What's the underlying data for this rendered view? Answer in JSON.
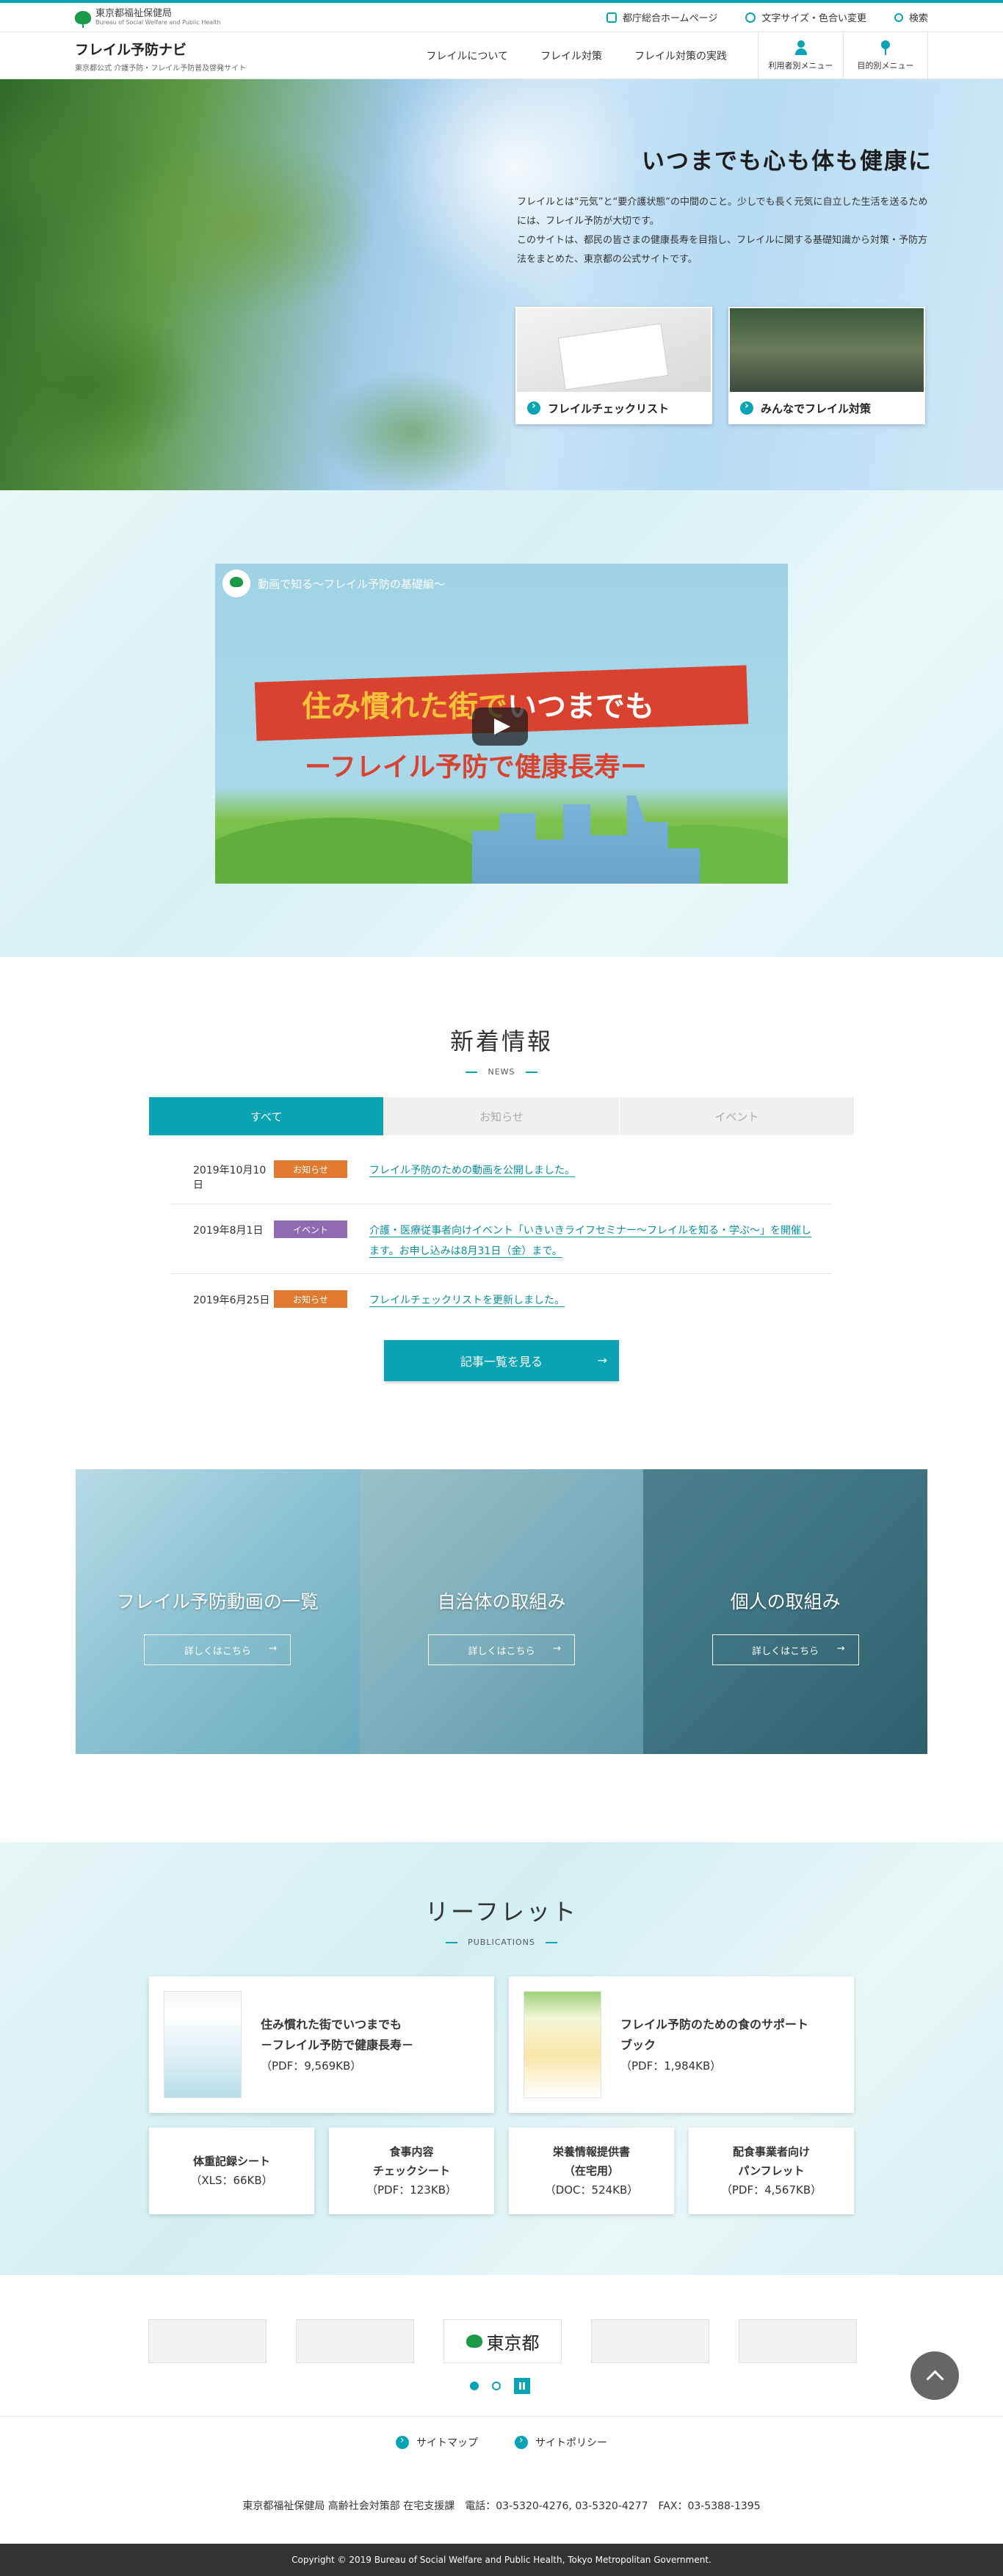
{
  "topbar": {
    "bureau_ja": "東京都福祉保健局",
    "bureau_en": "Bureau of Social Welfare and Public Health",
    "links": [
      {
        "label": "都庁総合ホームページ",
        "icon": "external-window-icon"
      },
      {
        "label": "文字サイズ・色合い変更",
        "icon": "gear-icon"
      },
      {
        "label": "検索",
        "icon": "search-icon"
      }
    ]
  },
  "header": {
    "title": "フレイル予防ナビ",
    "subtitle": "東京都公式 介護予防・フレイル予防普及啓発サイト",
    "nav": [
      "フレイルについて",
      "フレイル対策",
      "フレイル対策の実践"
    ],
    "menus": [
      {
        "label": "利用者別メニュー",
        "icon": "person-icon"
      },
      {
        "label": "目的別メニュー",
        "icon": "pin-icon"
      }
    ]
  },
  "hero": {
    "title": "いつまでも心も体も健康に",
    "desc1": "フレイルとは“元気”と“要介護状態”の中間のこと。少しでも長く元気に自立した生活を送るためには、フレイル予防が大切です。",
    "desc2": "このサイトは、都民の皆さまの健康長寿を目指し、フレイルに関する基礎知識から対策・予防方法をまとめた、東京都の公式サイトです。",
    "cards": [
      "フレイルチェックリスト",
      "みんなでフレイル対策"
    ]
  },
  "video": {
    "title": "動画で知る～フレイル予防の基礎編～",
    "line1_a": "住み慣れた街で",
    "line1_b": "いつまでも",
    "line2": "ーフレイル予防で健康長寿ー"
  },
  "news": {
    "title": "新着情報",
    "sub": "NEWS",
    "tabs": [
      "すべて",
      "お知らせ",
      "イベント"
    ],
    "items": [
      {
        "date": "2019年10月10日",
        "badge": "お知らせ",
        "color": "#e07a30",
        "title": "フレイル予防のための動画を公開しました。"
      },
      {
        "date": "2019年8月1日",
        "badge": "イベント",
        "color": "#8e6bb0",
        "title": "介護・医療従事者向けイベント「いきいきライフセミナー～フレイルを知る・学ぶ～」を開催します。お申し込みは8月31日（金）まで。"
      },
      {
        "date": "2019年6月25日",
        "badge": "お知らせ",
        "color": "#e07a30",
        "title": "フレイルチェックリストを更新しました。"
      }
    ],
    "more": "記事一覧を見る"
  },
  "features": {
    "items": [
      "フレイル予防動画の一覧",
      "自治体の取組み",
      "個人の取組み"
    ],
    "detail_label": "詳しくはこちら"
  },
  "leaflets": {
    "title": "リーフレット",
    "sub": "PUBLICATIONS",
    "big": [
      {
        "title": "住み慣れた街でいつまでも\n－フレイル予防で健康長寿－",
        "size": "（PDF：9,569KB）"
      },
      {
        "title": "フレイル予防のための食のサポート\nブック",
        "size": "（PDF：1,984KB）"
      }
    ],
    "small": [
      {
        "title": "体重記録シート",
        "size": "（XLS：66KB）"
      },
      {
        "title": "食事内容\nチェックシート",
        "size": "（PDF：123KB）"
      },
      {
        "title": "栄養情報提供書\n（在宅用）",
        "size": "（DOC：524KB）"
      },
      {
        "title": "配食事業者向け\nパンフレット",
        "size": "（PDF：4,567KB）"
      }
    ]
  },
  "banners": {
    "tokyo": "東京都"
  },
  "footer": {
    "links": [
      "サイトマップ",
      "サイトポリシー"
    ],
    "info": "東京都福祉保健局 高齢社会対策部 在宅支援課　電話：03-5320-4276, 03-5320-4277　FAX：03-5388-1395",
    "copyright": "Copyright © 2019 Bureau of Social Welfare and Public Health, Tokyo Metropolitan Government."
  }
}
